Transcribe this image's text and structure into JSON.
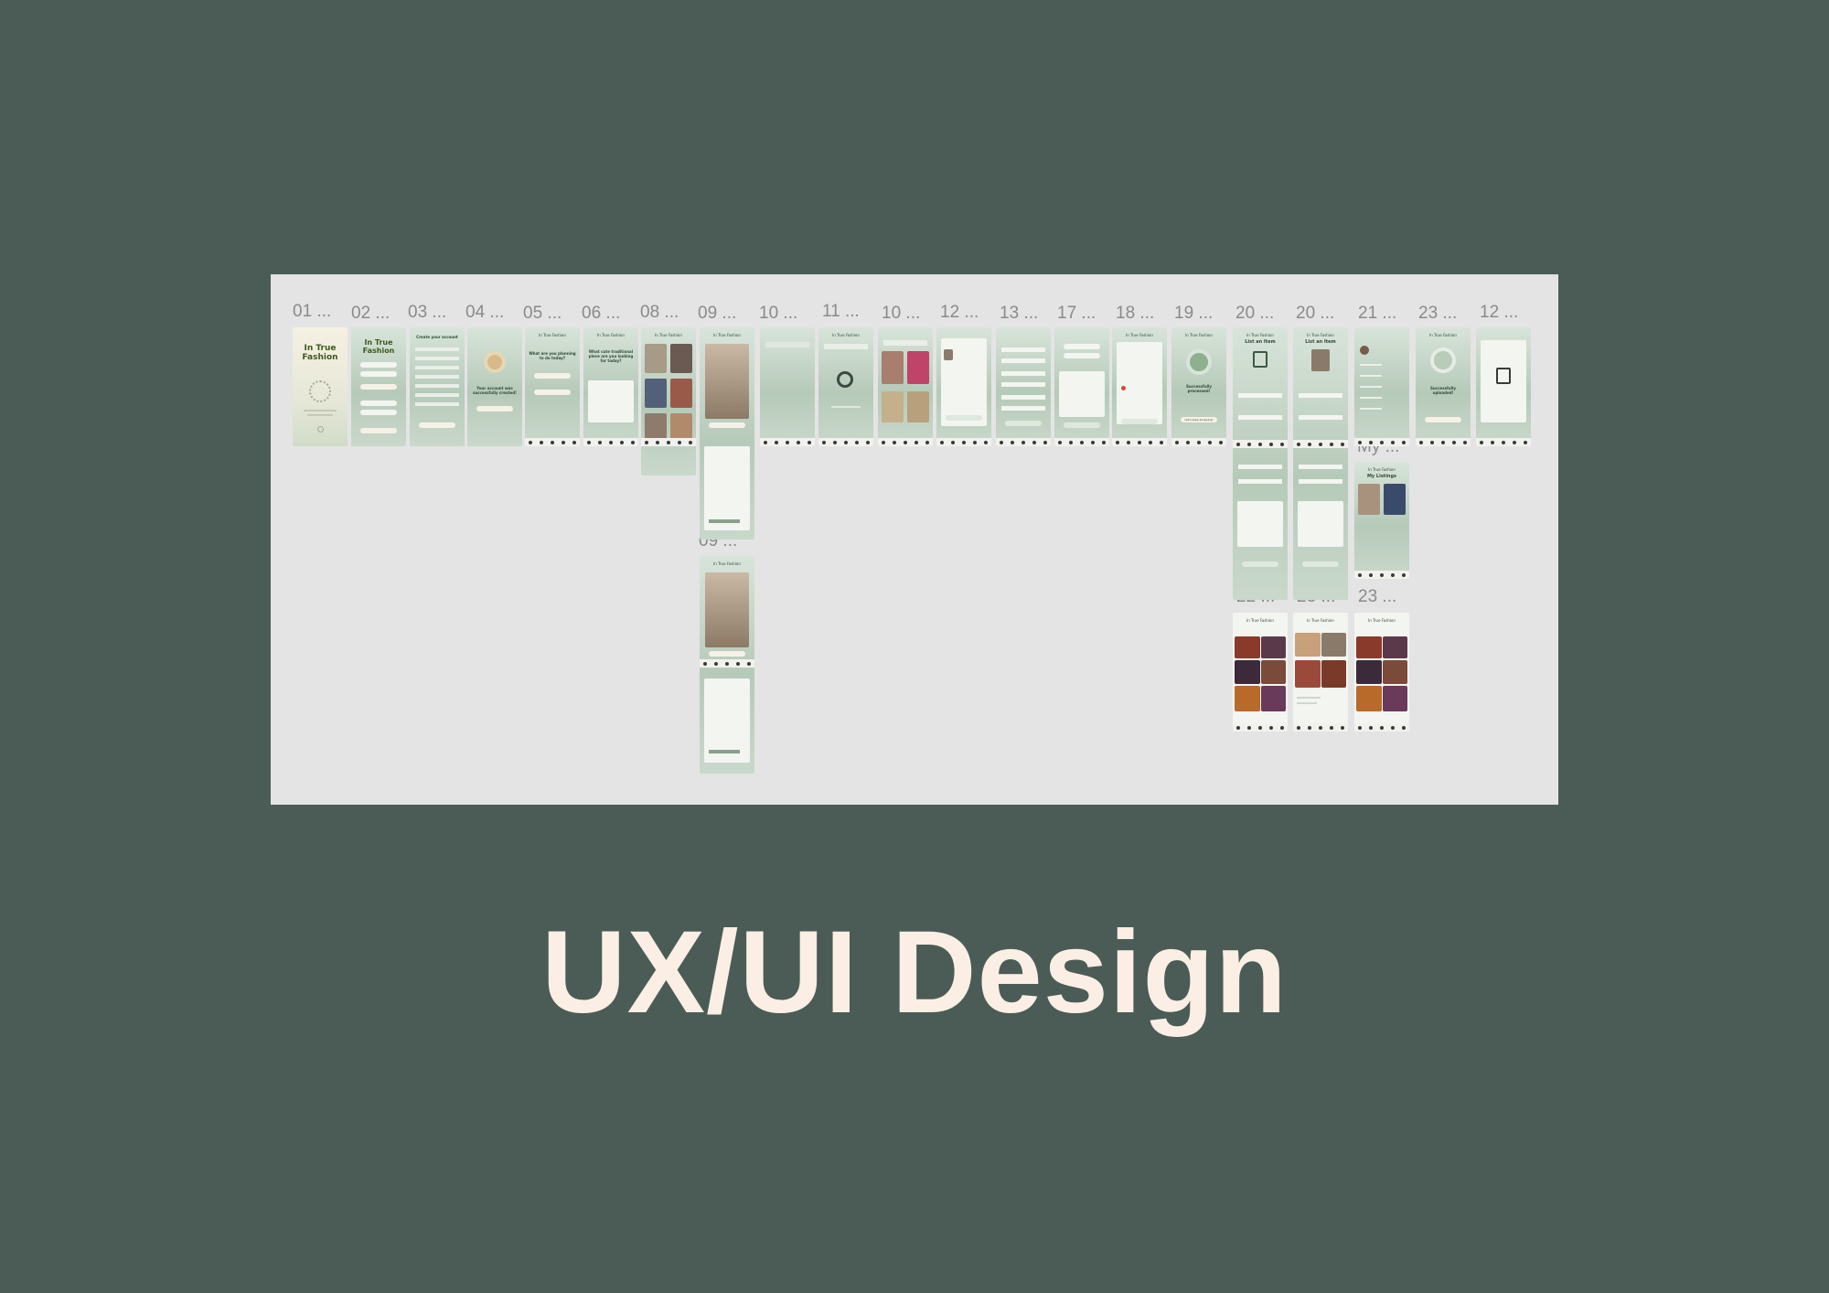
{
  "board": {
    "frame_labels": {
      "f01": "01 ...",
      "f02": "02 ...",
      "f03": "03 ...",
      "f04": "04 ...",
      "f05": "05 ...",
      "f06": "06 ...",
      "f08": "08 ...",
      "f09": "09 ...",
      "f10a": "10 ...",
      "f11": "11 ...",
      "f10b": "10 ...",
      "f12a": "12 ...",
      "f13": "13 ...",
      "f17": "17 ...",
      "f18": "18 ...",
      "f19": "19 ...",
      "f20a": "20 ...",
      "f20b": "20 ...",
      "f21": "21 ...",
      "f23a": "23 ...",
      "f12b": "12 ...",
      "f09b": "09 ...",
      "my": "My ...",
      "f22": "22 ...",
      "f23b": "23 ...",
      "f23c": "23 ..."
    },
    "frames": {
      "app_name_large": "In True Fashion",
      "app_name_small": "In True Fashion",
      "create_account": "Create your account",
      "account_created": "Your account was successfully created!",
      "get_started": "Let's get started",
      "question_1": "What are you planning to do today?",
      "question_2": "What cute traditional piece are you looking for today?",
      "add_to_cart": "Add to cart",
      "successfully_processed": "Successfully processed!",
      "keep_shopping": "Let's keep shopping!",
      "list_an_item": "List an Item",
      "successfully_uploaded": "Successfully uploaded!",
      "my_listings": "My Listings"
    }
  },
  "main_title": "UX/UI Design",
  "colors": {
    "background": "#4a5c55",
    "canvas": "#e4e4e4",
    "title": "#fbeee4",
    "frame_green": "#b6cab9",
    "brand_green": "#3e5a1e"
  }
}
